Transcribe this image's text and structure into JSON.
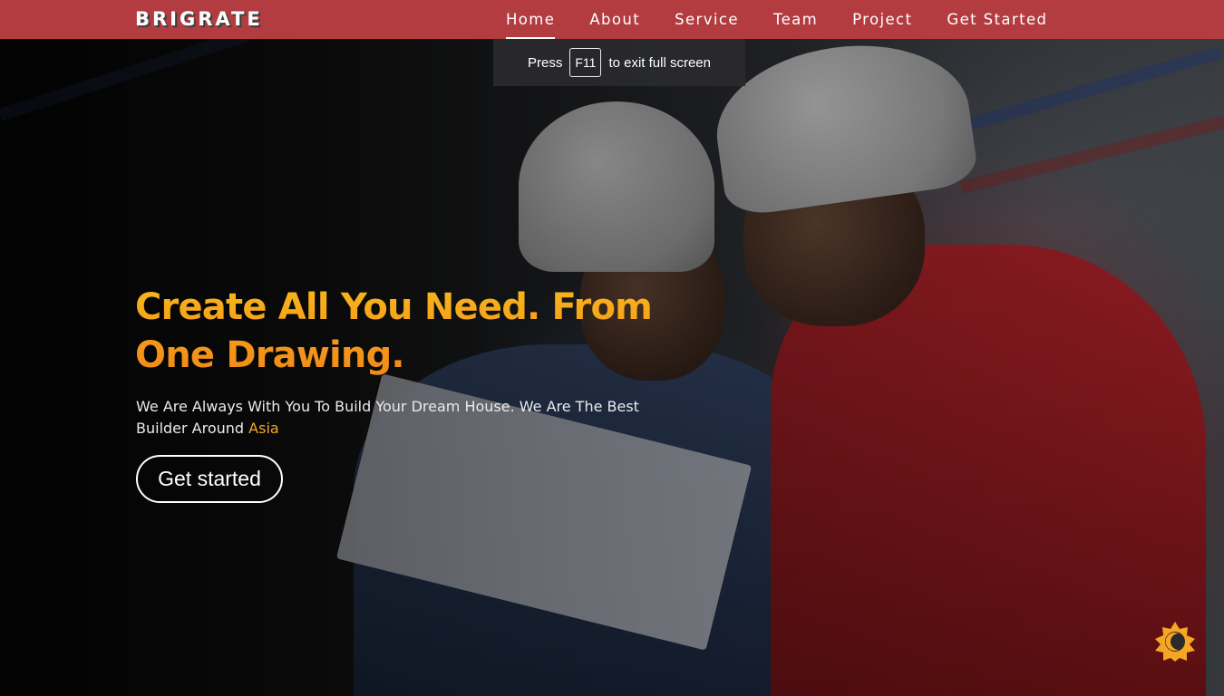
{
  "header": {
    "logo": "BRIGRATE",
    "nav": [
      {
        "label": "Home",
        "active": true
      },
      {
        "label": "About",
        "active": false
      },
      {
        "label": "Service",
        "active": false
      },
      {
        "label": "Team",
        "active": false
      },
      {
        "label": "Project",
        "active": false
      },
      {
        "label": "Get Started",
        "active": false
      }
    ]
  },
  "fullscreen_toast": {
    "prefix": "Press",
    "key": "F11",
    "suffix": "to exit full screen"
  },
  "hero": {
    "headline_line1": "Create All You Need. From",
    "headline_line2": "One Drawing.",
    "subtitle_main": "We Are Always With You To Build Your Dream House. We Are The Best Builder Around",
    "subtitle_accent": "Asia",
    "cta_label": "Get started"
  },
  "theme_toggle": {
    "icon": "sun-moon-icon",
    "color": "#f5a623"
  },
  "colors": {
    "header_bg": "#b23c40",
    "accent": "#f5a623",
    "text": "#ffffff"
  }
}
